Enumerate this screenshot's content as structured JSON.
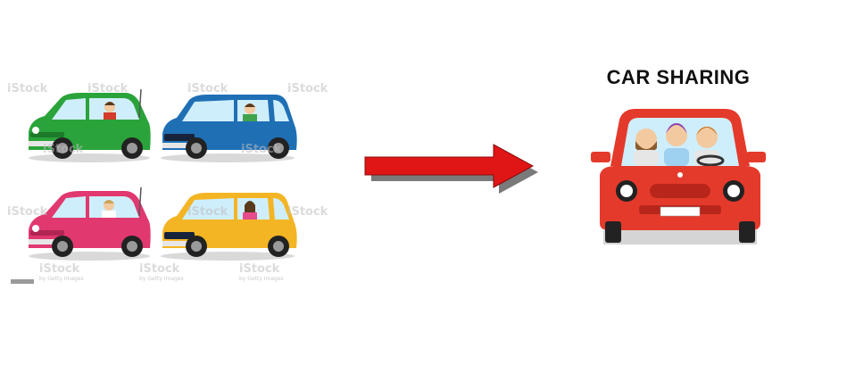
{
  "title": "CAR SHARING",
  "cars_left": [
    {
      "id": "green",
      "body": "#2aa43a",
      "dark": "#1c7a29"
    },
    {
      "id": "blue",
      "body": "#1f6fb5",
      "dark": "#17548a"
    },
    {
      "id": "pink",
      "body": "#e0386f",
      "dark": "#b12552"
    },
    {
      "id": "yellow",
      "body": "#f3b524",
      "dark": "#c98f12"
    }
  ],
  "arrow": {
    "color": "#e01616",
    "shadow": "#7a7a7a"
  },
  "shared_car": {
    "body": "#e43a2c",
    "dark": "#b8261b"
  },
  "watermark": {
    "brand": "iStock",
    "credit": "by Getty Images"
  }
}
